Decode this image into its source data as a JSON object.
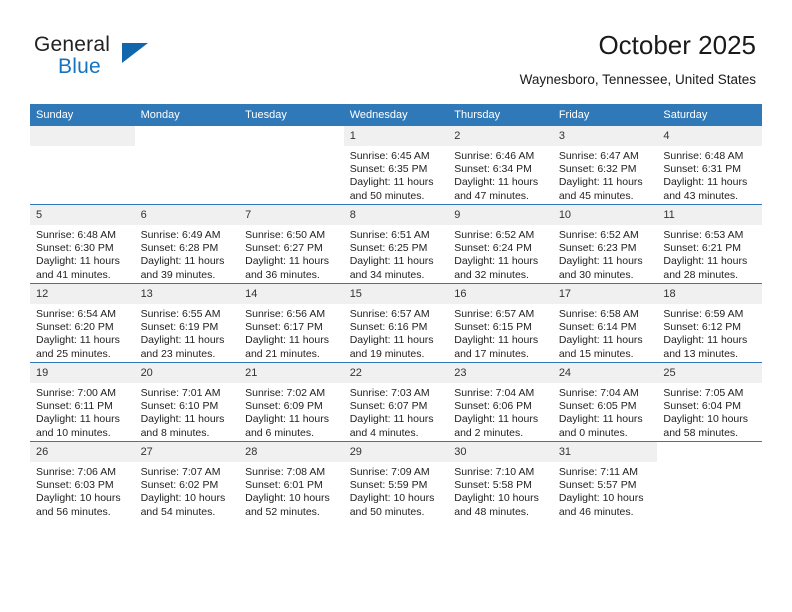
{
  "brand": {
    "name_part1": "General",
    "name_part2": "Blue",
    "logo_icon": "triangle-logo-icon"
  },
  "header": {
    "title": "October 2025",
    "location": "Waynesboro, Tennessee, United States"
  },
  "calendar": {
    "weekday_headers": [
      "Sunday",
      "Monday",
      "Tuesday",
      "Wednesday",
      "Thursday",
      "Friday",
      "Saturday"
    ],
    "accent_color": "#3079b8",
    "daynum_bg_color": "#f0f0f0",
    "weeks": [
      [
        {
          "day": "",
          "empty": true,
          "blank_strip": true,
          "sunrise": "",
          "sunset": "",
          "daylight_line1": "",
          "daylight_line2": ""
        },
        {
          "day": "",
          "empty": true,
          "blank_strip": false,
          "sunrise": "",
          "sunset": "",
          "daylight_line1": "",
          "daylight_line2": ""
        },
        {
          "day": "",
          "empty": true,
          "blank_strip": false,
          "sunrise": "",
          "sunset": "",
          "daylight_line1": "",
          "daylight_line2": ""
        },
        {
          "day": "1",
          "empty": false,
          "blank_strip": false,
          "sunrise": "Sunrise: 6:45 AM",
          "sunset": "Sunset: 6:35 PM",
          "daylight_line1": "Daylight: 11 hours",
          "daylight_line2": "and 50 minutes."
        },
        {
          "day": "2",
          "empty": false,
          "blank_strip": false,
          "sunrise": "Sunrise: 6:46 AM",
          "sunset": "Sunset: 6:34 PM",
          "daylight_line1": "Daylight: 11 hours",
          "daylight_line2": "and 47 minutes."
        },
        {
          "day": "3",
          "empty": false,
          "blank_strip": false,
          "sunrise": "Sunrise: 6:47 AM",
          "sunset": "Sunset: 6:32 PM",
          "daylight_line1": "Daylight: 11 hours",
          "daylight_line2": "and 45 minutes."
        },
        {
          "day": "4",
          "empty": false,
          "blank_strip": false,
          "sunrise": "Sunrise: 6:48 AM",
          "sunset": "Sunset: 6:31 PM",
          "daylight_line1": "Daylight: 11 hours",
          "daylight_line2": "and 43 minutes."
        }
      ],
      [
        {
          "day": "5",
          "empty": false,
          "blank_strip": false,
          "sunrise": "Sunrise: 6:48 AM",
          "sunset": "Sunset: 6:30 PM",
          "daylight_line1": "Daylight: 11 hours",
          "daylight_line2": "and 41 minutes."
        },
        {
          "day": "6",
          "empty": false,
          "blank_strip": false,
          "sunrise": "Sunrise: 6:49 AM",
          "sunset": "Sunset: 6:28 PM",
          "daylight_line1": "Daylight: 11 hours",
          "daylight_line2": "and 39 minutes."
        },
        {
          "day": "7",
          "empty": false,
          "blank_strip": false,
          "sunrise": "Sunrise: 6:50 AM",
          "sunset": "Sunset: 6:27 PM",
          "daylight_line1": "Daylight: 11 hours",
          "daylight_line2": "and 36 minutes."
        },
        {
          "day": "8",
          "empty": false,
          "blank_strip": false,
          "sunrise": "Sunrise: 6:51 AM",
          "sunset": "Sunset: 6:25 PM",
          "daylight_line1": "Daylight: 11 hours",
          "daylight_line2": "and 34 minutes."
        },
        {
          "day": "9",
          "empty": false,
          "blank_strip": false,
          "sunrise": "Sunrise: 6:52 AM",
          "sunset": "Sunset: 6:24 PM",
          "daylight_line1": "Daylight: 11 hours",
          "daylight_line2": "and 32 minutes."
        },
        {
          "day": "10",
          "empty": false,
          "blank_strip": false,
          "sunrise": "Sunrise: 6:52 AM",
          "sunset": "Sunset: 6:23 PM",
          "daylight_line1": "Daylight: 11 hours",
          "daylight_line2": "and 30 minutes."
        },
        {
          "day": "11",
          "empty": false,
          "blank_strip": false,
          "sunrise": "Sunrise: 6:53 AM",
          "sunset": "Sunset: 6:21 PM",
          "daylight_line1": "Daylight: 11 hours",
          "daylight_line2": "and 28 minutes."
        }
      ],
      [
        {
          "day": "12",
          "empty": false,
          "blank_strip": false,
          "sunrise": "Sunrise: 6:54 AM",
          "sunset": "Sunset: 6:20 PM",
          "daylight_line1": "Daylight: 11 hours",
          "daylight_line2": "and 25 minutes."
        },
        {
          "day": "13",
          "empty": false,
          "blank_strip": false,
          "sunrise": "Sunrise: 6:55 AM",
          "sunset": "Sunset: 6:19 PM",
          "daylight_line1": "Daylight: 11 hours",
          "daylight_line2": "and 23 minutes."
        },
        {
          "day": "14",
          "empty": false,
          "blank_strip": false,
          "sunrise": "Sunrise: 6:56 AM",
          "sunset": "Sunset: 6:17 PM",
          "daylight_line1": "Daylight: 11 hours",
          "daylight_line2": "and 21 minutes."
        },
        {
          "day": "15",
          "empty": false,
          "blank_strip": false,
          "sunrise": "Sunrise: 6:57 AM",
          "sunset": "Sunset: 6:16 PM",
          "daylight_line1": "Daylight: 11 hours",
          "daylight_line2": "and 19 minutes."
        },
        {
          "day": "16",
          "empty": false,
          "blank_strip": false,
          "sunrise": "Sunrise: 6:57 AM",
          "sunset": "Sunset: 6:15 PM",
          "daylight_line1": "Daylight: 11 hours",
          "daylight_line2": "and 17 minutes."
        },
        {
          "day": "17",
          "empty": false,
          "blank_strip": false,
          "sunrise": "Sunrise: 6:58 AM",
          "sunset": "Sunset: 6:14 PM",
          "daylight_line1": "Daylight: 11 hours",
          "daylight_line2": "and 15 minutes."
        },
        {
          "day": "18",
          "empty": false,
          "blank_strip": false,
          "sunrise": "Sunrise: 6:59 AM",
          "sunset": "Sunset: 6:12 PM",
          "daylight_line1": "Daylight: 11 hours",
          "daylight_line2": "and 13 minutes."
        }
      ],
      [
        {
          "day": "19",
          "empty": false,
          "blank_strip": false,
          "sunrise": "Sunrise: 7:00 AM",
          "sunset": "Sunset: 6:11 PM",
          "daylight_line1": "Daylight: 11 hours",
          "daylight_line2": "and 10 minutes."
        },
        {
          "day": "20",
          "empty": false,
          "blank_strip": false,
          "sunrise": "Sunrise: 7:01 AM",
          "sunset": "Sunset: 6:10 PM",
          "daylight_line1": "Daylight: 11 hours",
          "daylight_line2": "and 8 minutes."
        },
        {
          "day": "21",
          "empty": false,
          "blank_strip": false,
          "sunrise": "Sunrise: 7:02 AM",
          "sunset": "Sunset: 6:09 PM",
          "daylight_line1": "Daylight: 11 hours",
          "daylight_line2": "and 6 minutes."
        },
        {
          "day": "22",
          "empty": false,
          "blank_strip": false,
          "sunrise": "Sunrise: 7:03 AM",
          "sunset": "Sunset: 6:07 PM",
          "daylight_line1": "Daylight: 11 hours",
          "daylight_line2": "and 4 minutes."
        },
        {
          "day": "23",
          "empty": false,
          "blank_strip": false,
          "sunrise": "Sunrise: 7:04 AM",
          "sunset": "Sunset: 6:06 PM",
          "daylight_line1": "Daylight: 11 hours",
          "daylight_line2": "and 2 minutes."
        },
        {
          "day": "24",
          "empty": false,
          "blank_strip": false,
          "sunrise": "Sunrise: 7:04 AM",
          "sunset": "Sunset: 6:05 PM",
          "daylight_line1": "Daylight: 11 hours",
          "daylight_line2": "and 0 minutes."
        },
        {
          "day": "25",
          "empty": false,
          "blank_strip": false,
          "sunrise": "Sunrise: 7:05 AM",
          "sunset": "Sunset: 6:04 PM",
          "daylight_line1": "Daylight: 10 hours",
          "daylight_line2": "and 58 minutes."
        }
      ],
      [
        {
          "day": "26",
          "empty": false,
          "blank_strip": false,
          "sunrise": "Sunrise: 7:06 AM",
          "sunset": "Sunset: 6:03 PM",
          "daylight_line1": "Daylight: 10 hours",
          "daylight_line2": "and 56 minutes."
        },
        {
          "day": "27",
          "empty": false,
          "blank_strip": false,
          "sunrise": "Sunrise: 7:07 AM",
          "sunset": "Sunset: 6:02 PM",
          "daylight_line1": "Daylight: 10 hours",
          "daylight_line2": "and 54 minutes."
        },
        {
          "day": "28",
          "empty": false,
          "blank_strip": false,
          "sunrise": "Sunrise: 7:08 AM",
          "sunset": "Sunset: 6:01 PM",
          "daylight_line1": "Daylight: 10 hours",
          "daylight_line2": "and 52 minutes."
        },
        {
          "day": "29",
          "empty": false,
          "blank_strip": false,
          "sunrise": "Sunrise: 7:09 AM",
          "sunset": "Sunset: 5:59 PM",
          "daylight_line1": "Daylight: 10 hours",
          "daylight_line2": "and 50 minutes."
        },
        {
          "day": "30",
          "empty": false,
          "blank_strip": false,
          "sunrise": "Sunrise: 7:10 AM",
          "sunset": "Sunset: 5:58 PM",
          "daylight_line1": "Daylight: 10 hours",
          "daylight_line2": "and 48 minutes."
        },
        {
          "day": "31",
          "empty": false,
          "blank_strip": false,
          "sunrise": "Sunrise: 7:11 AM",
          "sunset": "Sunset: 5:57 PM",
          "daylight_line1": "Daylight: 10 hours",
          "daylight_line2": "and 46 minutes."
        },
        {
          "day": "",
          "empty": true,
          "blank_strip": false,
          "sunrise": "",
          "sunset": "",
          "daylight_line1": "",
          "daylight_line2": ""
        }
      ]
    ]
  }
}
